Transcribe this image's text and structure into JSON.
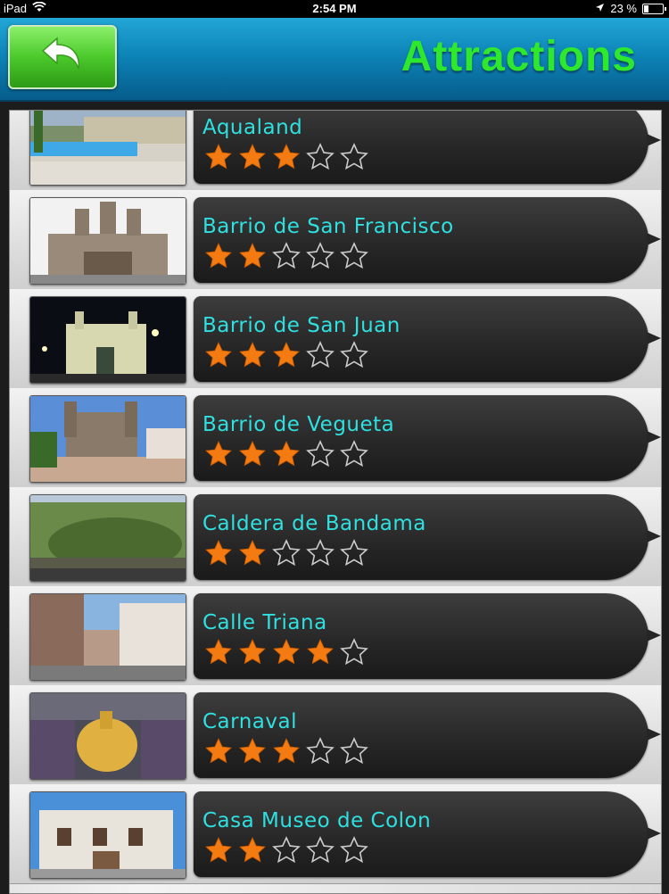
{
  "status_bar": {
    "device": "iPad",
    "time": "2:54 PM",
    "battery": "23 %",
    "battery_level": 0.23
  },
  "header": {
    "title": "Attractions",
    "back_icon": "back-arrow-icon"
  },
  "colors": {
    "title": "#2ee82e",
    "item_name": "#2fe0e0",
    "star_filled": "#f47a12",
    "star_empty": "#cccccc"
  },
  "attractions": [
    {
      "name": "Aqualand",
      "rating": 3
    },
    {
      "name": "Barrio de San Francisco",
      "rating": 2
    },
    {
      "name": "Barrio de San Juan",
      "rating": 3
    },
    {
      "name": "Barrio de Vegueta",
      "rating": 3
    },
    {
      "name": "Caldera de Bandama",
      "rating": 2
    },
    {
      "name": "Calle Triana",
      "rating": 4
    },
    {
      "name": "Carnaval",
      "rating": 3
    },
    {
      "name": "Casa Museo de Colon",
      "rating": 2
    }
  ],
  "rating_max": 5
}
